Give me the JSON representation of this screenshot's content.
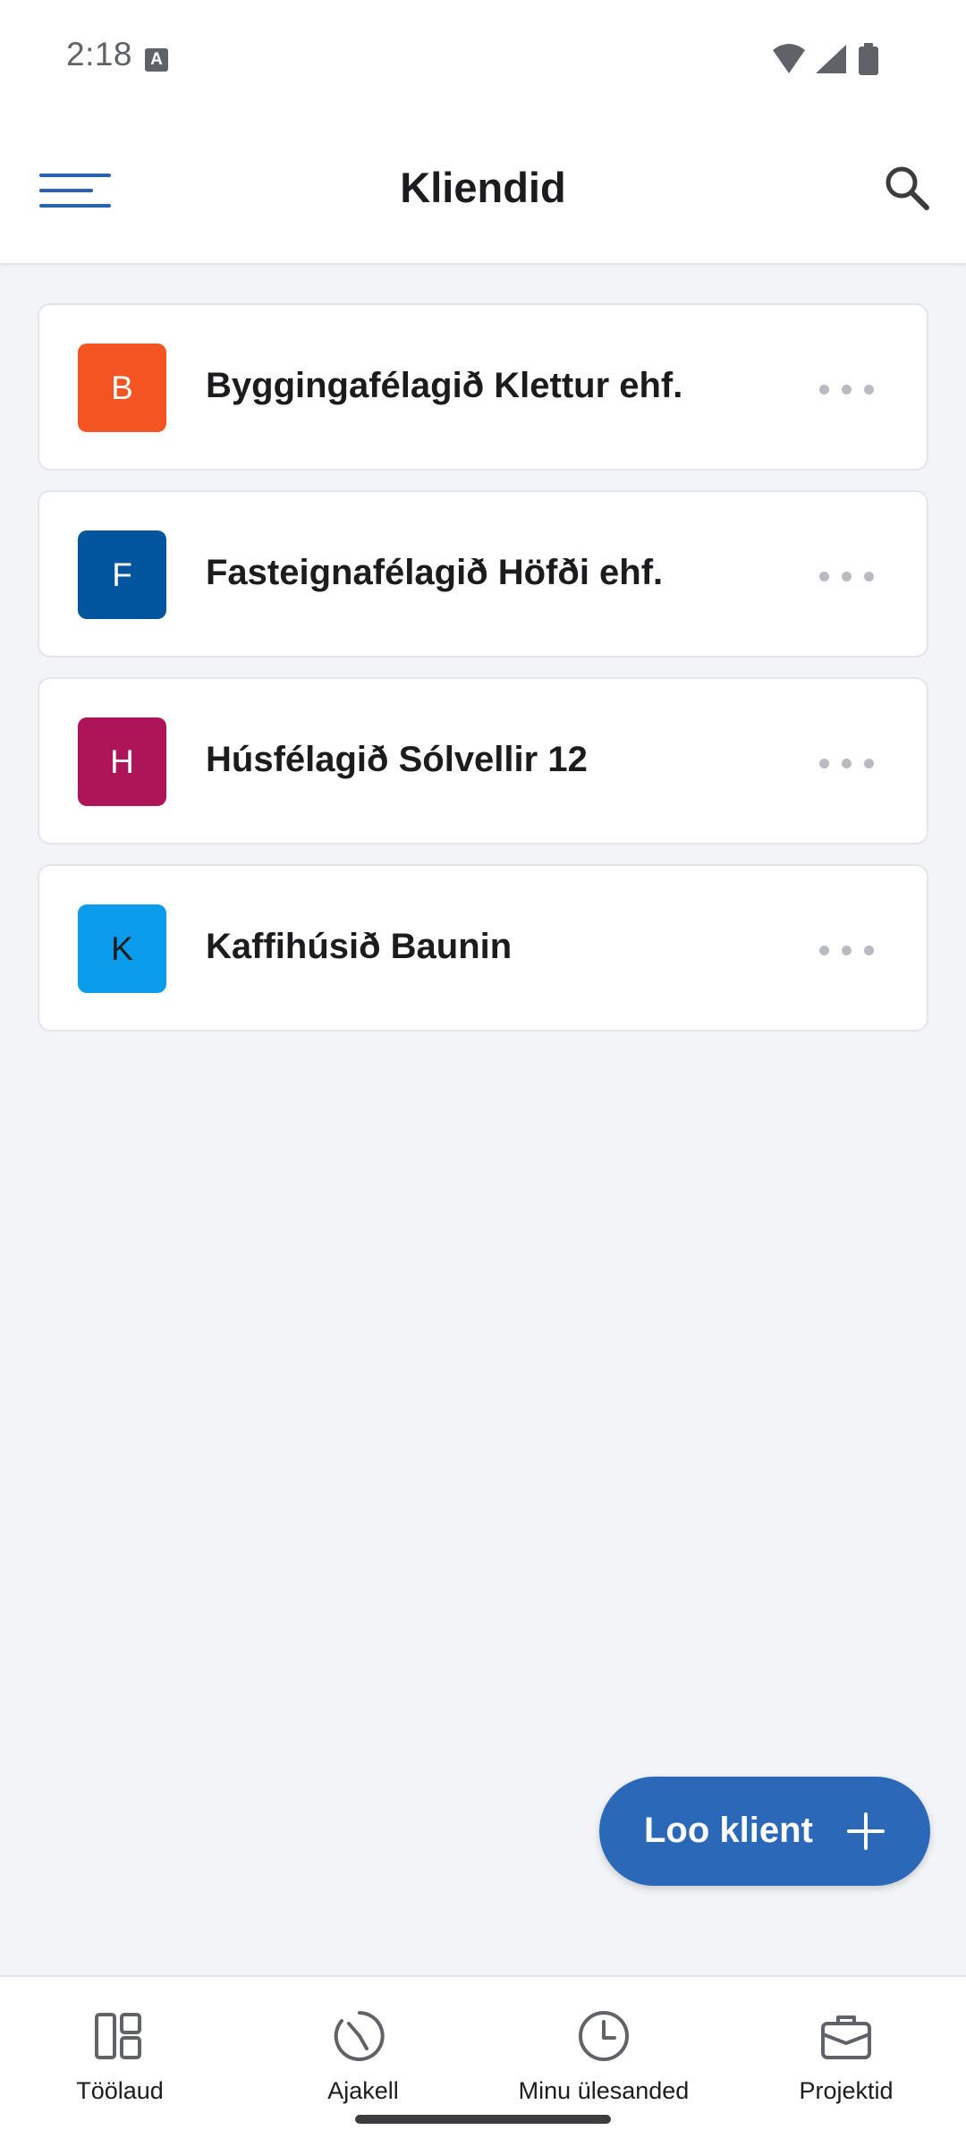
{
  "status_bar": {
    "time": "2:18",
    "notification_icon": "a-icon",
    "right_icons": [
      "wifi-icon",
      "signal-icon",
      "battery-icon"
    ]
  },
  "header": {
    "title": "Kliendid",
    "menu_icon": "hamburger-menu-icon",
    "search_icon": "search-icon"
  },
  "clients": [
    {
      "initial": "B",
      "name": "Byggingafélagið Klettur ehf.",
      "color": "#f35421"
    },
    {
      "initial": "F",
      "name": "Fasteignafélagið Höfði ehf.",
      "color": "#00569e"
    },
    {
      "initial": "H",
      "name": "Húsfélagið Sólvellir 12",
      "color": "#ae1558"
    },
    {
      "initial": "K",
      "name": "Kaffihúsið Baunin",
      "color": "#0b9deb"
    }
  ],
  "fab": {
    "label": "Loo klient",
    "icon": "plus-icon",
    "color": "#2b68b8"
  },
  "bottom_nav": [
    {
      "label": "Töölaud",
      "icon": "dashboard-icon"
    },
    {
      "label": "Ajakell",
      "icon": "timer-icon"
    },
    {
      "label": "Minu ülesanded",
      "icon": "clock-icon"
    },
    {
      "label": "Projektid",
      "icon": "briefcase-icon"
    }
  ],
  "colors": {
    "accent": "#2b68b8",
    "background": "#f3f4f7",
    "card": "#ffffff"
  }
}
